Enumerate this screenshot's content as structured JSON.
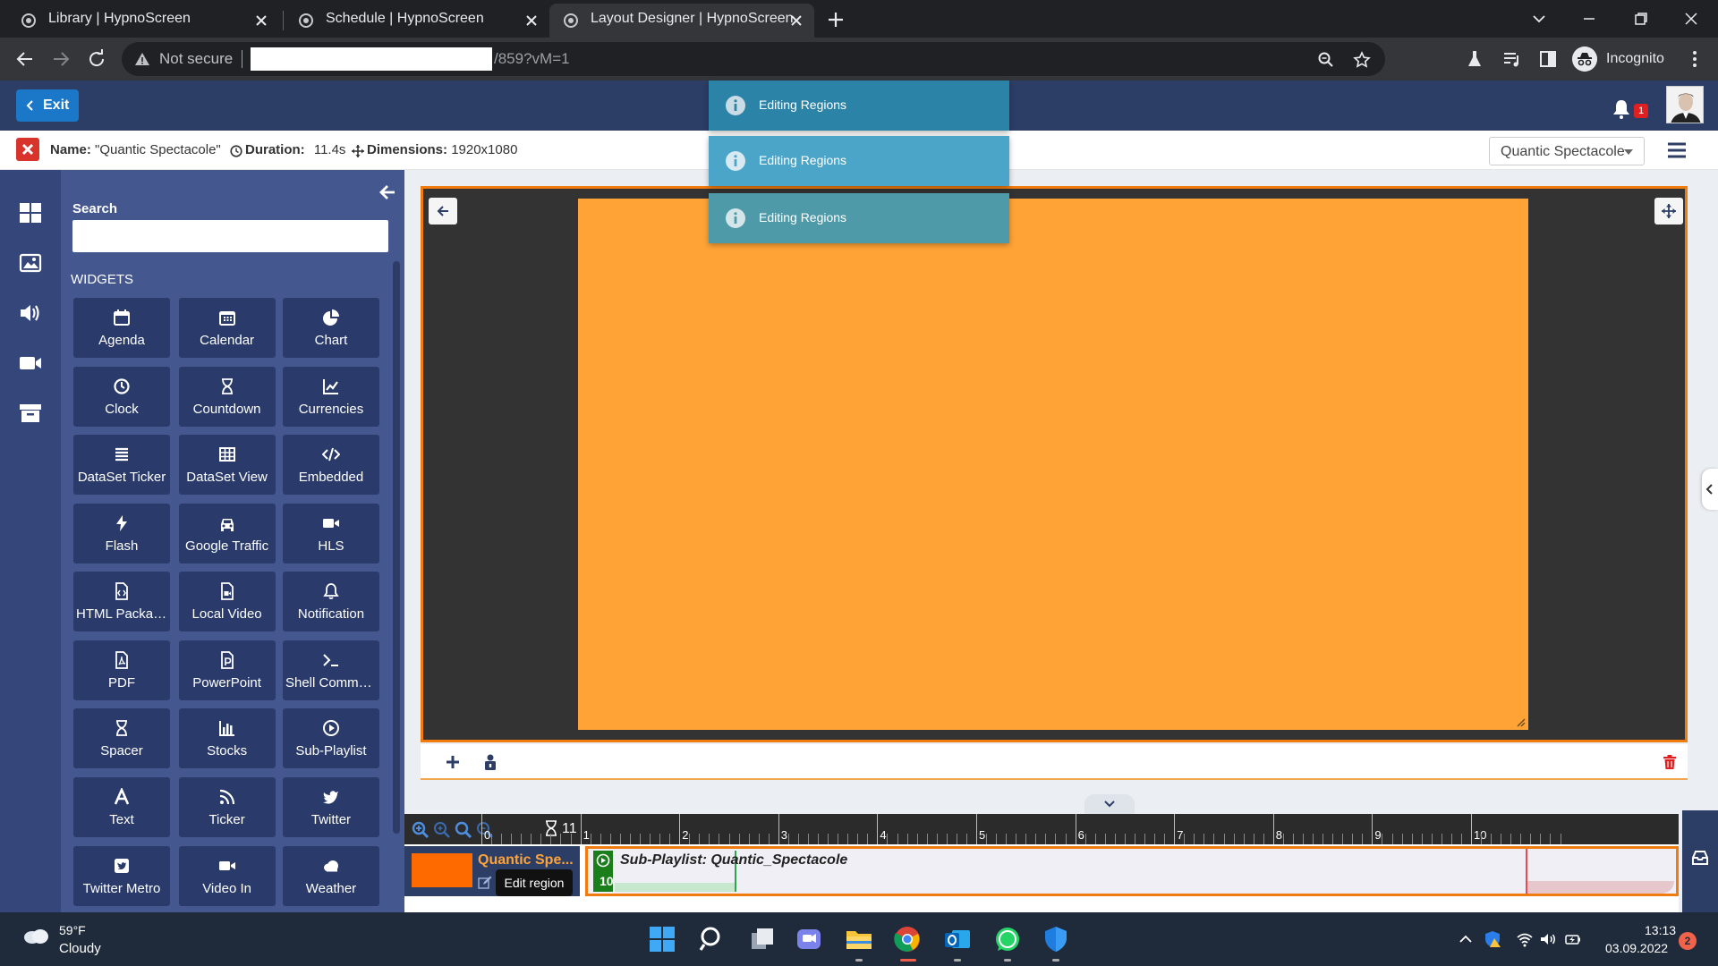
{
  "browser": {
    "tabs": [
      {
        "title": "Library | HypnoScreen",
        "active": false
      },
      {
        "title": "Schedule | HypnoScreen",
        "active": false
      },
      {
        "title": "Layout Designer | HypnoScreen",
        "active": true
      }
    ],
    "security_label": "Not secure",
    "url_suffix": "/859?vM=1",
    "profile_label": "Incognito"
  },
  "header": {
    "exit_label": "Exit",
    "notification_count": "1"
  },
  "layout_info": {
    "name_label": "Name:",
    "name_value": "\"Quantic Spectacole\"",
    "duration_label": "Duration:",
    "duration_value": "11.4s",
    "dimensions_label": "Dimensions:",
    "dimensions_value": "1920x1080",
    "selected_layout": "Quantic Spectacole"
  },
  "toasts": [
    {
      "message": "Editing Regions"
    },
    {
      "message": "Editing Regions"
    },
    {
      "message": "Editing Regions"
    }
  ],
  "widget_panel": {
    "search_label": "Search",
    "search_value": "",
    "section_label": "WIDGETS",
    "widgets": [
      {
        "label": "Agenda",
        "icon": "calendar-icon"
      },
      {
        "label": "Calendar",
        "icon": "calendar-grid-icon"
      },
      {
        "label": "Chart",
        "icon": "pie-chart-icon"
      },
      {
        "label": "Clock",
        "icon": "clock-icon"
      },
      {
        "label": "Countdown",
        "icon": "hourglass-icon"
      },
      {
        "label": "Currencies",
        "icon": "line-chart-icon"
      },
      {
        "label": "DataSet Ticker",
        "icon": "list-icon"
      },
      {
        "label": "DataSet View",
        "icon": "table-icon"
      },
      {
        "label": "Embedded",
        "icon": "code-icon"
      },
      {
        "label": "Flash",
        "icon": "bolt-icon"
      },
      {
        "label": "Google Traffic",
        "icon": "car-icon"
      },
      {
        "label": "HLS",
        "icon": "video-camera-icon"
      },
      {
        "label": "HTML Package",
        "icon": "file-code-icon"
      },
      {
        "label": "Local Video",
        "icon": "file-video-icon"
      },
      {
        "label": "Notification",
        "icon": "bell-icon"
      },
      {
        "label": "PDF",
        "icon": "file-pdf-icon"
      },
      {
        "label": "PowerPoint",
        "icon": "file-powerpoint-icon"
      },
      {
        "label": "Shell Comma...",
        "icon": "terminal-icon"
      },
      {
        "label": "Spacer",
        "icon": "hourglass-icon"
      },
      {
        "label": "Stocks",
        "icon": "bar-chart-icon"
      },
      {
        "label": "Sub-Playlist",
        "icon": "play-circle-icon"
      },
      {
        "label": "Text",
        "icon": "font-icon"
      },
      {
        "label": "Ticker",
        "icon": "rss-icon"
      },
      {
        "label": "Twitter",
        "icon": "twitter-icon"
      },
      {
        "label": "Twitter Metro",
        "icon": "twitter-square-icon"
      },
      {
        "label": "Video In",
        "icon": "video-camera-icon"
      },
      {
        "label": "Weather",
        "icon": "cloud-icon"
      }
    ]
  },
  "timeline": {
    "duration": "11",
    "ticks": [
      "0",
      "1",
      "2",
      "3",
      "4",
      "5",
      "6",
      "7",
      "8",
      "9",
      "10"
    ],
    "region_name": "Quantic Spe...",
    "tooltip": "Edit region",
    "subplaylist_name": "Sub-Playlist: Quantic_Spectacole",
    "item_count": "10"
  },
  "taskbar": {
    "temperature": "59°F",
    "condition": "Cloudy",
    "time": "13:13",
    "date": "03.09.2022",
    "notification_count": "2"
  },
  "colors": {
    "header": "#2c3e66",
    "accent_orange": "#f07c10",
    "region_fill": "#ffa336",
    "toast_1": "#2b83a8",
    "toast_2": "#4ba5c8",
    "toast_3": "#4f9aa8"
  }
}
